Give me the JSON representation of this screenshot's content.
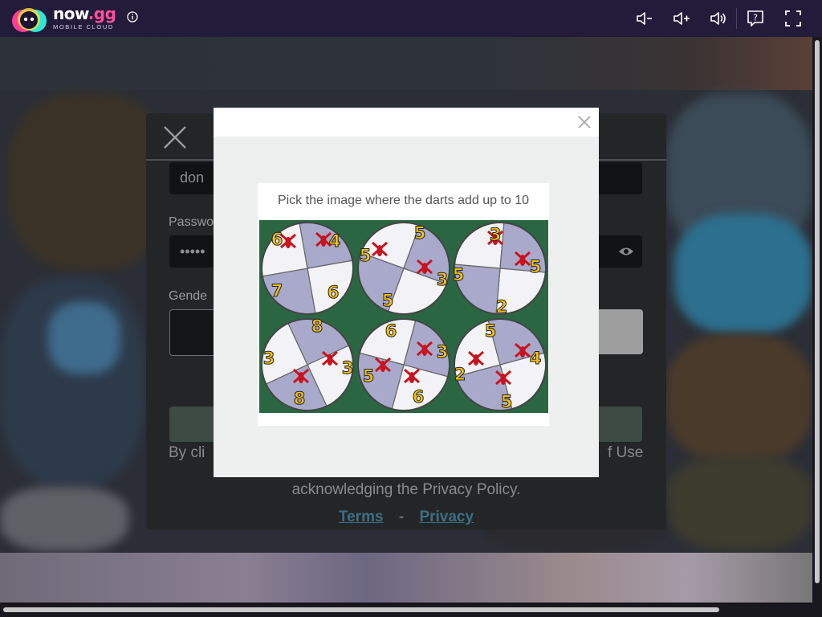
{
  "topbar": {
    "brand_name": "now",
    "brand_suffix": ".gg",
    "brand_subtitle": "MOBILE CLOUD",
    "icons": [
      "info-icon",
      "volume-down-icon",
      "volume-up-icon",
      "volume-icon",
      "help-icon",
      "fullscreen-icon"
    ]
  },
  "signup": {
    "username_value": "don",
    "password_label": "Passwo",
    "password_value": "•••••",
    "gender_label": "Gende",
    "legal_start": "By cli",
    "legal_end": "f Use",
    "legal_line2": "acknowledging the Privacy Policy.",
    "terms_link": "Terms",
    "separator": "-",
    "privacy_link": "Privacy"
  },
  "captcha": {
    "prompt": "Pick the image where the darts add up to 10",
    "colors": {
      "board_bg": "#2a6642",
      "slice_white": "#f2f2f7",
      "slice_lavender": "#a9a9cc",
      "number": "#f5c211",
      "dart": "#c8141e"
    },
    "options": [
      {
        "id": "1",
        "numbers": [
          "6",
          "4",
          "7",
          "6"
        ]
      },
      {
        "id": "2",
        "numbers": [
          "5",
          "5",
          "3",
          "5"
        ]
      },
      {
        "id": "3",
        "numbers": [
          "3",
          "5",
          "5",
          "2"
        ]
      },
      {
        "id": "4",
        "numbers": [
          "8",
          "3",
          "3",
          "8"
        ]
      },
      {
        "id": "5",
        "numbers": [
          "6",
          "3",
          "5",
          "6"
        ]
      },
      {
        "id": "6",
        "numbers": [
          "5",
          "4",
          "2",
          "5"
        ]
      }
    ]
  }
}
